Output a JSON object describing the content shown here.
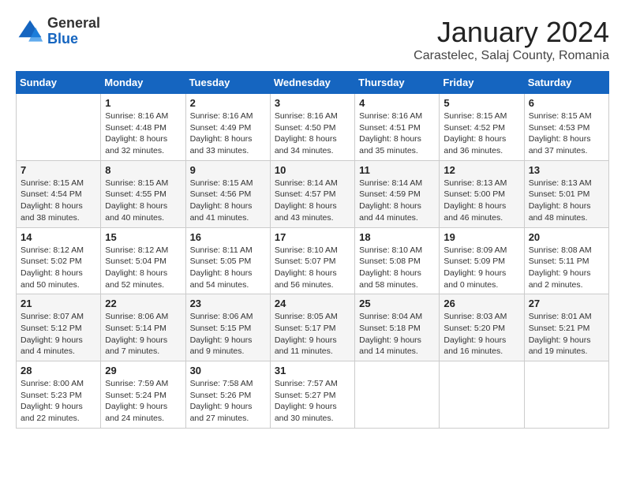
{
  "header": {
    "logo_line1": "General",
    "logo_line2": "Blue",
    "month": "January 2024",
    "location": "Carastelec, Salaj County, Romania"
  },
  "weekdays": [
    "Sunday",
    "Monday",
    "Tuesday",
    "Wednesday",
    "Thursday",
    "Friday",
    "Saturday"
  ],
  "weeks": [
    [
      {
        "day": "",
        "info": ""
      },
      {
        "day": "1",
        "info": "Sunrise: 8:16 AM\nSunset: 4:48 PM\nDaylight: 8 hours\nand 32 minutes."
      },
      {
        "day": "2",
        "info": "Sunrise: 8:16 AM\nSunset: 4:49 PM\nDaylight: 8 hours\nand 33 minutes."
      },
      {
        "day": "3",
        "info": "Sunrise: 8:16 AM\nSunset: 4:50 PM\nDaylight: 8 hours\nand 34 minutes."
      },
      {
        "day": "4",
        "info": "Sunrise: 8:16 AM\nSunset: 4:51 PM\nDaylight: 8 hours\nand 35 minutes."
      },
      {
        "day": "5",
        "info": "Sunrise: 8:15 AM\nSunset: 4:52 PM\nDaylight: 8 hours\nand 36 minutes."
      },
      {
        "day": "6",
        "info": "Sunrise: 8:15 AM\nSunset: 4:53 PM\nDaylight: 8 hours\nand 37 minutes."
      }
    ],
    [
      {
        "day": "7",
        "info": "Sunrise: 8:15 AM\nSunset: 4:54 PM\nDaylight: 8 hours\nand 38 minutes."
      },
      {
        "day": "8",
        "info": "Sunrise: 8:15 AM\nSunset: 4:55 PM\nDaylight: 8 hours\nand 40 minutes."
      },
      {
        "day": "9",
        "info": "Sunrise: 8:15 AM\nSunset: 4:56 PM\nDaylight: 8 hours\nand 41 minutes."
      },
      {
        "day": "10",
        "info": "Sunrise: 8:14 AM\nSunset: 4:57 PM\nDaylight: 8 hours\nand 43 minutes."
      },
      {
        "day": "11",
        "info": "Sunrise: 8:14 AM\nSunset: 4:59 PM\nDaylight: 8 hours\nand 44 minutes."
      },
      {
        "day": "12",
        "info": "Sunrise: 8:13 AM\nSunset: 5:00 PM\nDaylight: 8 hours\nand 46 minutes."
      },
      {
        "day": "13",
        "info": "Sunrise: 8:13 AM\nSunset: 5:01 PM\nDaylight: 8 hours\nand 48 minutes."
      }
    ],
    [
      {
        "day": "14",
        "info": "Sunrise: 8:12 AM\nSunset: 5:02 PM\nDaylight: 8 hours\nand 50 minutes."
      },
      {
        "day": "15",
        "info": "Sunrise: 8:12 AM\nSunset: 5:04 PM\nDaylight: 8 hours\nand 52 minutes."
      },
      {
        "day": "16",
        "info": "Sunrise: 8:11 AM\nSunset: 5:05 PM\nDaylight: 8 hours\nand 54 minutes."
      },
      {
        "day": "17",
        "info": "Sunrise: 8:10 AM\nSunset: 5:07 PM\nDaylight: 8 hours\nand 56 minutes."
      },
      {
        "day": "18",
        "info": "Sunrise: 8:10 AM\nSunset: 5:08 PM\nDaylight: 8 hours\nand 58 minutes."
      },
      {
        "day": "19",
        "info": "Sunrise: 8:09 AM\nSunset: 5:09 PM\nDaylight: 9 hours\nand 0 minutes."
      },
      {
        "day": "20",
        "info": "Sunrise: 8:08 AM\nSunset: 5:11 PM\nDaylight: 9 hours\nand 2 minutes."
      }
    ],
    [
      {
        "day": "21",
        "info": "Sunrise: 8:07 AM\nSunset: 5:12 PM\nDaylight: 9 hours\nand 4 minutes."
      },
      {
        "day": "22",
        "info": "Sunrise: 8:06 AM\nSunset: 5:14 PM\nDaylight: 9 hours\nand 7 minutes."
      },
      {
        "day": "23",
        "info": "Sunrise: 8:06 AM\nSunset: 5:15 PM\nDaylight: 9 hours\nand 9 minutes."
      },
      {
        "day": "24",
        "info": "Sunrise: 8:05 AM\nSunset: 5:17 PM\nDaylight: 9 hours\nand 11 minutes."
      },
      {
        "day": "25",
        "info": "Sunrise: 8:04 AM\nSunset: 5:18 PM\nDaylight: 9 hours\nand 14 minutes."
      },
      {
        "day": "26",
        "info": "Sunrise: 8:03 AM\nSunset: 5:20 PM\nDaylight: 9 hours\nand 16 minutes."
      },
      {
        "day": "27",
        "info": "Sunrise: 8:01 AM\nSunset: 5:21 PM\nDaylight: 9 hours\nand 19 minutes."
      }
    ],
    [
      {
        "day": "28",
        "info": "Sunrise: 8:00 AM\nSunset: 5:23 PM\nDaylight: 9 hours\nand 22 minutes."
      },
      {
        "day": "29",
        "info": "Sunrise: 7:59 AM\nSunset: 5:24 PM\nDaylight: 9 hours\nand 24 minutes."
      },
      {
        "day": "30",
        "info": "Sunrise: 7:58 AM\nSunset: 5:26 PM\nDaylight: 9 hours\nand 27 minutes."
      },
      {
        "day": "31",
        "info": "Sunrise: 7:57 AM\nSunset: 5:27 PM\nDaylight: 9 hours\nand 30 minutes."
      },
      {
        "day": "",
        "info": ""
      },
      {
        "day": "",
        "info": ""
      },
      {
        "day": "",
        "info": ""
      }
    ]
  ]
}
